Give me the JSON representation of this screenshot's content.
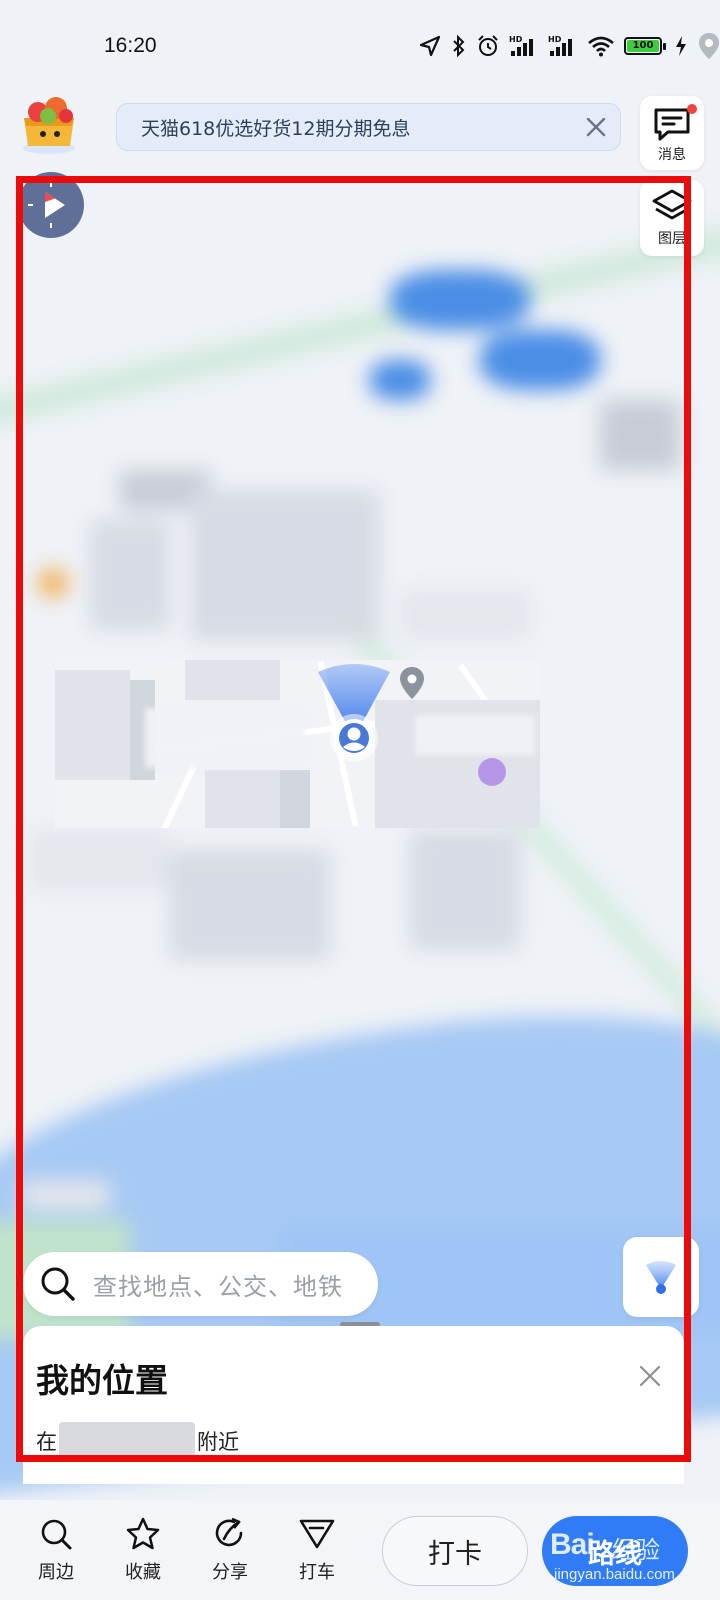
{
  "status_bar": {
    "time": "16:20",
    "battery": "100",
    "icons": [
      "location-arrow-icon",
      "bluetooth-icon",
      "alarm-icon",
      "signal-hd-icon",
      "signal-hd-icon",
      "wifi-icon",
      "battery-icon",
      "charging-icon",
      "map-pin-icon"
    ]
  },
  "banner": {
    "text": "天猫618优选好货12期分期免息",
    "close_icon": "close-icon"
  },
  "tools": {
    "messages_label": "消息",
    "layers_label": "图层"
  },
  "search": {
    "placeholder": "查找地点、公交、地铁"
  },
  "sheet": {
    "title": "我的位置",
    "prefix": "在",
    "suffix": "附近"
  },
  "nav": {
    "items": [
      {
        "label": "周边",
        "icon": "search-icon"
      },
      {
        "label": "收藏",
        "icon": "star-icon"
      },
      {
        "label": "分享",
        "icon": "share-icon"
      },
      {
        "label": "打车",
        "icon": "taxi-icon"
      }
    ],
    "checkin_label": "打卡",
    "route_label": "路线"
  },
  "watermark": {
    "logo": "Bai",
    "cn": "经验",
    "url": "jingyan.baidu.com"
  },
  "colors": {
    "accent": "#2f7cf6",
    "highlight_frame": "#ec0b0b",
    "water": "#a7c9f4",
    "banner_bg": "#e4ecfa"
  }
}
